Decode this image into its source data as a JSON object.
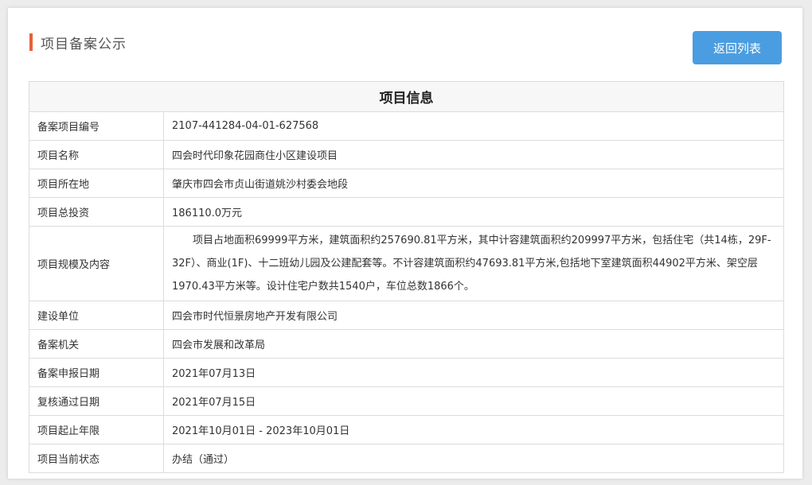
{
  "page": {
    "title": "项目备案公示",
    "back_button": "返回列表"
  },
  "table": {
    "header": "项目信息",
    "rows": [
      {
        "label": "备案项目编号",
        "value": "2107-441284-04-01-627568"
      },
      {
        "label": "项目名称",
        "value": "四会时代印象花园商住小区建设项目"
      },
      {
        "label": "项目所在地",
        "value": "肇庆市四会市贞山街道姚沙村委会地段"
      },
      {
        "label": "项目总投资",
        "value": "186110.0万元"
      },
      {
        "label": "项目规模及内容",
        "value": "项目占地面积69999平方米，建筑面积约257690.81平方米，其中计容建筑面积约209997平方米，包括住宅（共14栋，29F-32F）、商业(1F)、十二班幼儿园及公建配套等。不计容建筑面积约47693.81平方米,包括地下室建筑面积44902平方米、架空层1970.43平方米等。设计住宅户数共1540户，车位总数1866个。"
      },
      {
        "label": "建设单位",
        "value": "四会市时代恒景房地产开发有限公司"
      },
      {
        "label": "备案机关",
        "value": "四会市发展和改革局"
      },
      {
        "label": "备案申报日期",
        "value": "2021年07月13日"
      },
      {
        "label": "复核通过日期",
        "value": "2021年07月15日"
      },
      {
        "label": "项目起止年限",
        "value": "2021年10月01日 - 2023年10月01日"
      },
      {
        "label": "项目当前状态",
        "value": "办结（通过）"
      }
    ]
  }
}
